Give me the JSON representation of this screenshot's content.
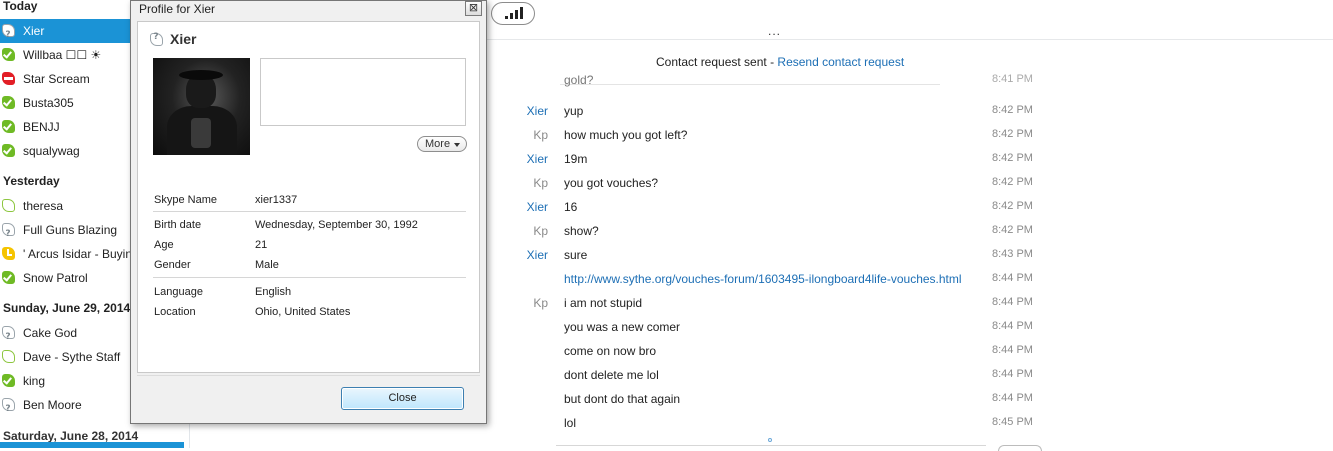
{
  "sidebar": {
    "groups": [
      {
        "title": "Today",
        "contacts": [
          {
            "name": "Xier",
            "status": "offline-q",
            "selected": true
          },
          {
            "name": "Willbaa ☐☐ ☀",
            "status": "online"
          },
          {
            "name": "Star Scream",
            "status": "busy"
          },
          {
            "name": "Busta305",
            "status": "online"
          },
          {
            "name": "BENJJ",
            "status": "online"
          },
          {
            "name": "squalywag",
            "status": "online"
          }
        ]
      },
      {
        "title": "Yesterday",
        "contacts": [
          {
            "name": "theresa",
            "status": "offline-g"
          },
          {
            "name": "Full Guns Blazing",
            "status": "offline-q"
          },
          {
            "name": "' Arcus Isidar - Buying",
            "status": "away"
          },
          {
            "name": "Snow Patrol",
            "status": "online"
          }
        ]
      },
      {
        "title": "Sunday, June 29, 2014",
        "contacts": [
          {
            "name": "Cake God",
            "status": "offline-q"
          },
          {
            "name": "Dave - Sythe Staff",
            "status": "offline-g"
          },
          {
            "name": "king",
            "status": "online"
          },
          {
            "name": "Ben Moore",
            "status": "offline-q"
          }
        ]
      }
    ],
    "cut_header": "Saturday, June 28, 2014"
  },
  "topbar": {
    "more_dots": "..."
  },
  "chat": {
    "request_text": "Contact request sent - ",
    "request_link": "Resend contact request",
    "messages": [
      {
        "sender": "",
        "text": "gold?",
        "time": "8:41 PM"
      },
      {
        "sender": "Xier",
        "text": "yup",
        "time": "8:42 PM"
      },
      {
        "sender": "Kp",
        "text": "how much you got left?",
        "time": "8:42 PM"
      },
      {
        "sender": "Xier",
        "text": "19m",
        "time": "8:42 PM"
      },
      {
        "sender": "Kp",
        "text": "you got vouches?",
        "time": "8:42 PM"
      },
      {
        "sender": "Xier",
        "text": "16",
        "time": "8:42 PM"
      },
      {
        "sender": "Kp",
        "text": "show?",
        "time": "8:42 PM"
      },
      {
        "sender": "Xier",
        "text": "sure",
        "time": "8:43 PM"
      },
      {
        "sender": "",
        "text": "http://www.sythe.org/vouches-forum/1603495-ilongboard4life-vouches.html",
        "time": "8:44 PM",
        "link": true
      },
      {
        "sender": "Kp",
        "text": "i am not stupid",
        "time": "8:44 PM"
      },
      {
        "sender": "",
        "text": "you was a new comer",
        "time": "8:44 PM"
      },
      {
        "sender": "",
        "text": "come on now bro",
        "time": "8:44 PM"
      },
      {
        "sender": "",
        "text": "dont delete me lol",
        "time": "8:44 PM"
      },
      {
        "sender": "",
        "text": "but dont do that again",
        "time": "8:44 PM"
      },
      {
        "sender": "",
        "text": "lol",
        "time": "8:45 PM"
      }
    ]
  },
  "dialog": {
    "title": "Profile for Xier",
    "close_x": "⊠",
    "name": "Xier",
    "more_label": "More",
    "fields": {
      "skype_name_label": "Skype Name",
      "skype_name": "xier1337",
      "birth_label": "Birth date",
      "birth": "Wednesday, September 30, 1992",
      "age_label": "Age",
      "age": "21",
      "gender_label": "Gender",
      "gender": "Male",
      "language_label": "Language",
      "language": "English",
      "location_label": "Location",
      "location": "Ohio, United States"
    },
    "close_label": "Close"
  }
}
